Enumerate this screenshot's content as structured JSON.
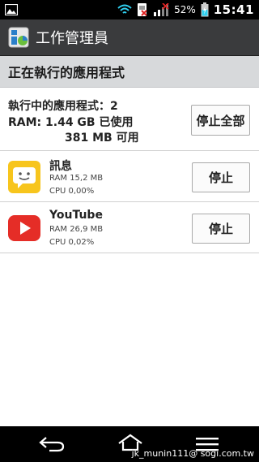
{
  "statusbar": {
    "time": "15:41",
    "battery_pct": "52%",
    "icons": [
      "image-icon",
      "wifi-icon",
      "sim-error-icon",
      "signal-icon",
      "battery-charging-icon"
    ]
  },
  "app": {
    "title": "工作管理員",
    "icon": "task-manager-icon"
  },
  "section": {
    "title": "正在執行的應用程式"
  },
  "summary": {
    "running_label": "執行中的應用程式：2",
    "ram_used": "RAM: 1.44 GB 已使用",
    "ram_free": "381 MB 可用",
    "stop_all_label": "停止全部"
  },
  "apps": [
    {
      "name": "訊息",
      "ram": "RAM 15,2 MB",
      "cpu": "CPU 0,00%",
      "icon": "messages-icon",
      "stop_label": "停止"
    },
    {
      "name": "YouTube",
      "ram": "RAM 26,9 MB",
      "cpu": "CPU 0,02%",
      "icon": "youtube-icon",
      "stop_label": "停止"
    }
  ],
  "navbar": {
    "icons": [
      "back-icon",
      "home-icon",
      "menu-icon"
    ],
    "watermark": "jk_munin111@ sogi.com.tw"
  },
  "colors": {
    "appbar": "#3a3b3d",
    "section": "#d7d9db",
    "youtube_red": "#e52d27",
    "message_yellow": "#f7c51d"
  }
}
